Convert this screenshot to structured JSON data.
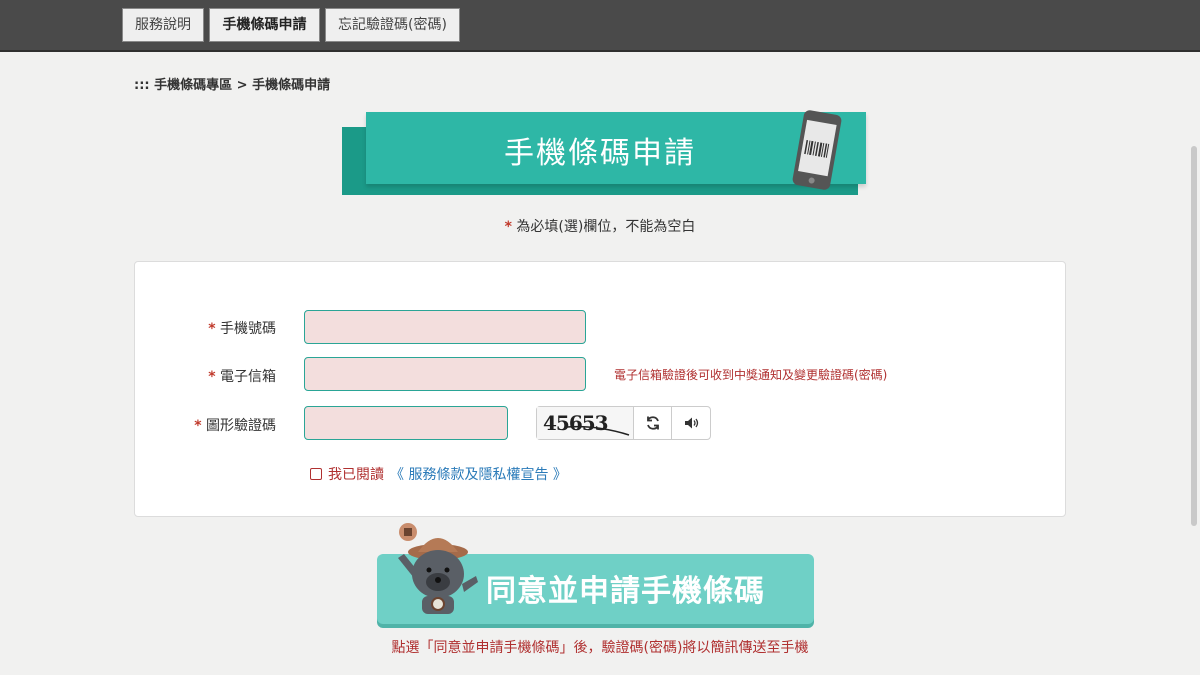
{
  "nav": {
    "tabs": [
      {
        "label": "服務說明"
      },
      {
        "label": "手機條碼申請"
      },
      {
        "label": "忘記驗證碼(密碼)"
      }
    ]
  },
  "breadcrumb": "::: 手機條碼專區 > 手機條碼申請",
  "banner": {
    "title": "手機條碼申請"
  },
  "required_note": {
    "star": "*",
    "text": " 為必填(選)欄位，不能為空白"
  },
  "form": {
    "phone": {
      "label": "手機號碼",
      "value": ""
    },
    "email": {
      "label": "電子信箱",
      "value": "",
      "hint": "電子信箱驗證後可收到中獎通知及變更驗證碼(密碼)"
    },
    "captcha": {
      "label": "圖形驗證碼",
      "value": "",
      "image_text": "45653"
    },
    "required_mark": "*",
    "agree": {
      "prefix": "我已閱讀",
      "link": "《 服務條款及隱私權宣告 》",
      "checked": false
    }
  },
  "submit": {
    "label": "同意並申請手機條碼"
  },
  "footer_note": "點選「同意並申請手機條碼」後，驗證碼(密碼)將以簡訊傳送至手機",
  "colors": {
    "accent": "#2eb7a6",
    "accent_dark": "#1b9a88",
    "required": "#c0392b",
    "link": "#2b7bb9",
    "input_bg": "#f3dedd"
  }
}
